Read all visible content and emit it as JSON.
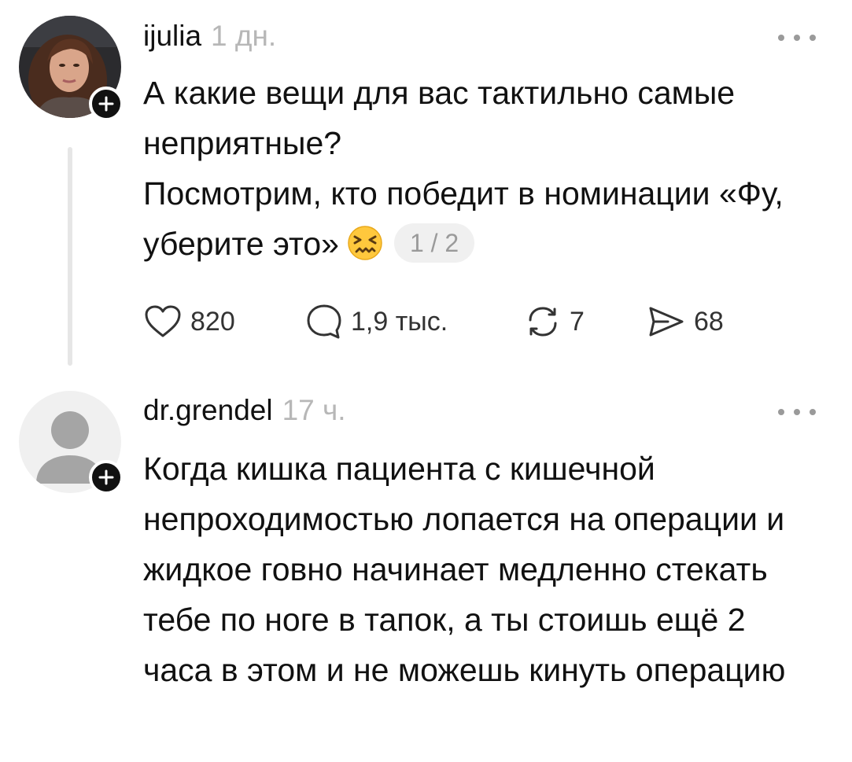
{
  "posts": [
    {
      "username": "ijulia",
      "time": "1 дн.",
      "text": [
        "А какие вещи для вас тактильно самые неприятные?",
        "Посмотрим, кто победит в номинации «Фу, уберите это»"
      ],
      "emoji": "confounded-face-icon",
      "page_indicator": "1 / 2",
      "likes": "820",
      "comments": "1,9 тыс.",
      "reposts": "7",
      "shares": "68"
    },
    {
      "username": "dr.grendel",
      "time": "17 ч.",
      "text": [
        "Когда кишка пациента с кишечной непроходимостью лопается на операции и жидкое говно начинает медленно стекать тебе по ноге в тапок, а ты стоишь ещё 2 часа в этом и не можешь кинуть операцию"
      ]
    }
  ],
  "icons": {
    "like": "heart-icon",
    "comment": "comment-bubble-icon",
    "repost": "repost-icon",
    "share": "send-icon",
    "more": "more-dots-icon",
    "follow": "plus-icon"
  },
  "colors": {
    "text": "#111111",
    "muted": "#b7b7b7",
    "chip_bg": "#f0f0f0",
    "thread_line": "#e6e6e6"
  }
}
